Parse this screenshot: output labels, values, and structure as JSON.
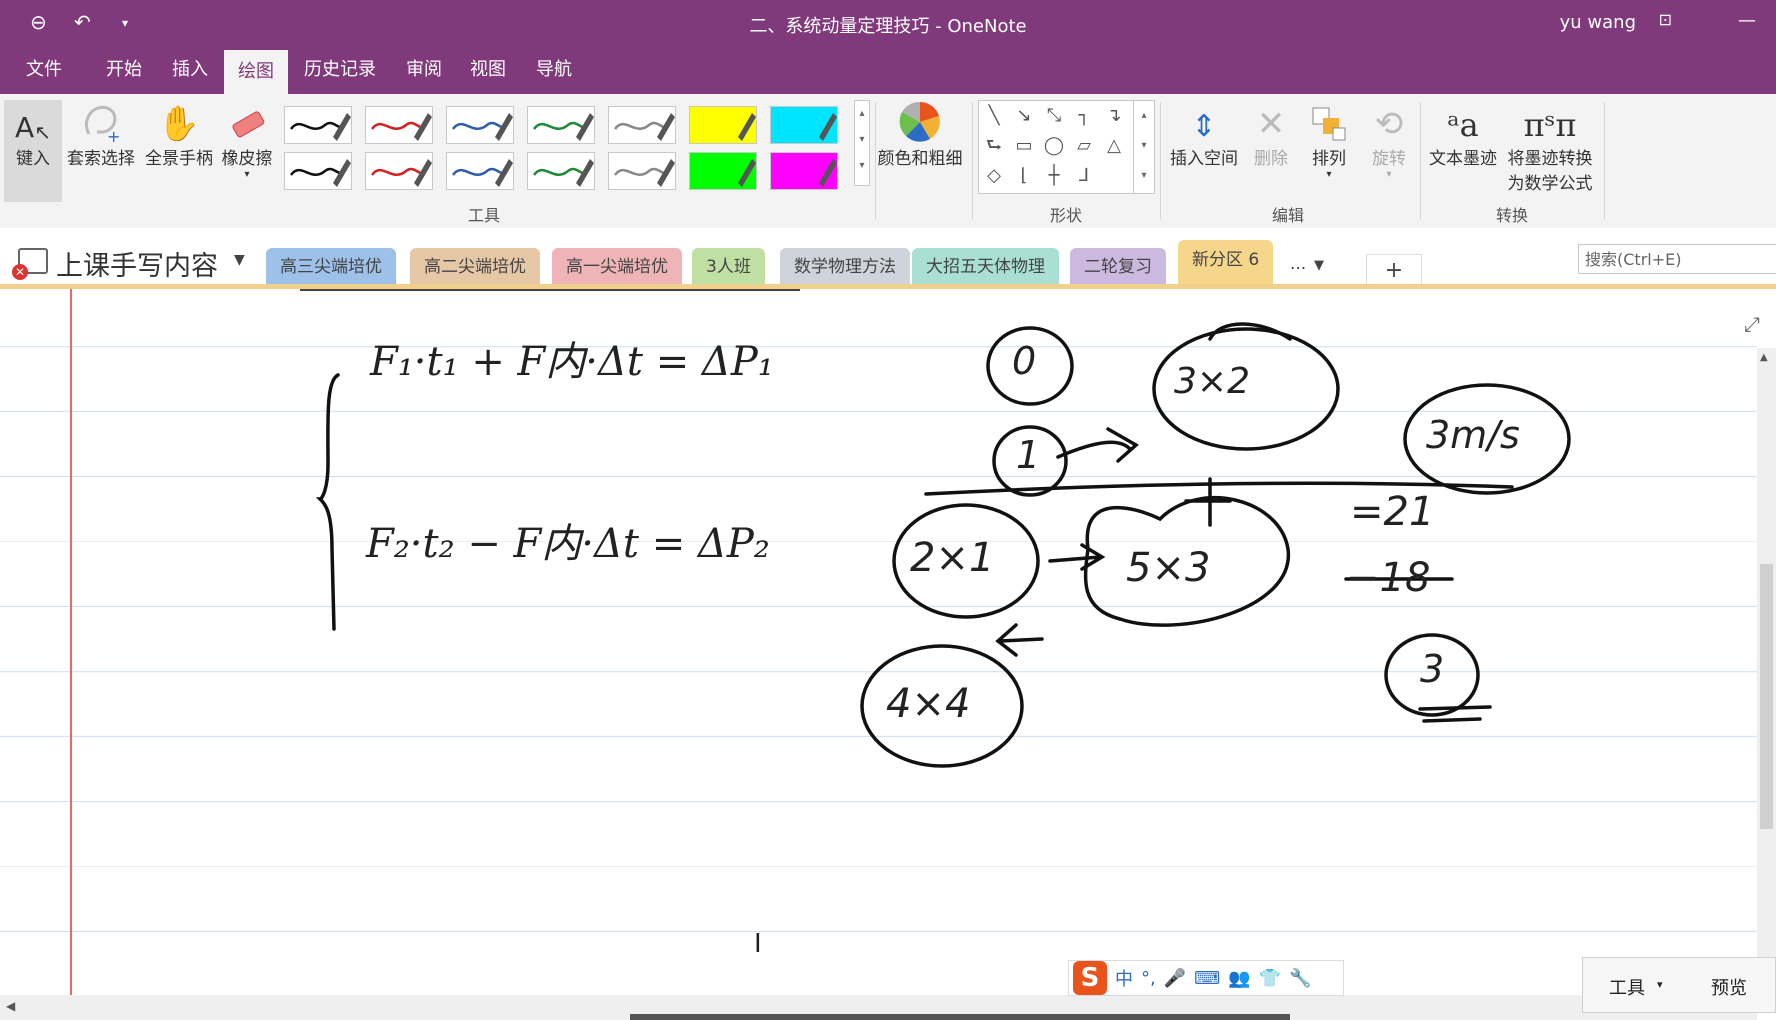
{
  "window": {
    "title": "二、系统动量定理技巧 - OneNote",
    "user": "yu wang",
    "accent": "#80397b"
  },
  "quick_access": [
    "back-icon",
    "undo-icon",
    "customize-dropdown-icon"
  ],
  "menu": {
    "items": [
      "文件",
      "开始",
      "插入",
      "绘图",
      "历史记录",
      "审阅",
      "视图",
      "导航"
    ],
    "active": "绘图"
  },
  "ribbon": {
    "tools": {
      "type": "键入",
      "lasso": "套索选择",
      "pan": "全景手柄",
      "eraser": "橡皮擦"
    },
    "pens_label": "工具",
    "pen_colors_row1": [
      "#111111",
      "#d42020",
      "#2f5fa8",
      "#1e8a3a",
      "#888888",
      "#ffff00",
      "#00e5ff"
    ],
    "pen_colors_row2": [
      "#111111",
      "#d42020",
      "#2f5fa8",
      "#1e8a3a",
      "#888888",
      "#00ff00",
      "#ff00ff"
    ],
    "color_thickness": "颜色和粗细",
    "shapes_label": "形状",
    "edit": {
      "insert_space": "插入空间",
      "delete": "删除",
      "arrange": "排列",
      "rotate": "旋转",
      "label": "编辑"
    },
    "convert": {
      "ink_to_text": "文本墨迹",
      "ink_to_math_l1": "将墨迹转换",
      "ink_to_math_l2": "为数学公式",
      "label": "转换"
    }
  },
  "notebook": {
    "name": "上课手写内容"
  },
  "sections": [
    {
      "label": "高三尖端培优",
      "color": "#9dc1e8"
    },
    {
      "label": "高二尖端培优",
      "color": "#e6c7a6"
    },
    {
      "label": "高一尖端培优",
      "color": "#efb4b8"
    },
    {
      "label": "3人班",
      "color": "#bfe0a2"
    },
    {
      "label": "数学物理方法",
      "color": "#cfd4dc"
    },
    {
      "label": "大招五天体物理",
      "color": "#a9e0d3"
    },
    {
      "label": "二轮复习",
      "color": "#ccb9e0"
    },
    {
      "label": "新分区 6",
      "color": "#f6d68a",
      "active": true
    }
  ],
  "more_sections": "...",
  "add_section": "+",
  "search": {
    "placeholder": "搜索(Ctrl+E)"
  },
  "page_ink": {
    "eq1": "F₁·t₁ + F内·Δt = ΔP₁",
    "eq2": "F₂·t₂ − F内·Δt = ΔP₂",
    "calc": [
      "0",
      "3×2",
      "1",
      "3m/s",
      "2×1",
      "5×3",
      "4×4",
      "=21",
      "−18",
      "3"
    ]
  },
  "ime": {
    "logo": "S",
    "mode": "中"
  },
  "bottom_tools": {
    "tools": "工具",
    "preview": "预览"
  }
}
